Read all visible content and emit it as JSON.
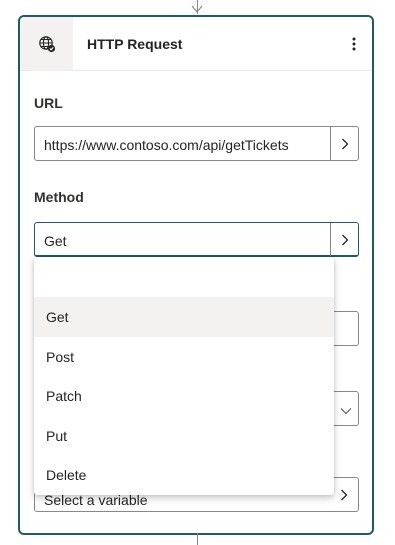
{
  "card": {
    "title": "HTTP Request",
    "icon": "globe-network-icon"
  },
  "url_field": {
    "label": "URL",
    "value": "https://www.contoso.com/api/getTickets"
  },
  "method_field": {
    "label": "Method",
    "value": "Get"
  },
  "dropdown": {
    "options": [
      "Get",
      "Post",
      "Patch",
      "Put",
      "Delete"
    ],
    "selected": "Get"
  },
  "bottom_field": {
    "placeholder": "Select a variable"
  },
  "colors": {
    "accent": "#1f5c63",
    "border": "#8a8886",
    "selected_bg": "#f3f2f1"
  }
}
